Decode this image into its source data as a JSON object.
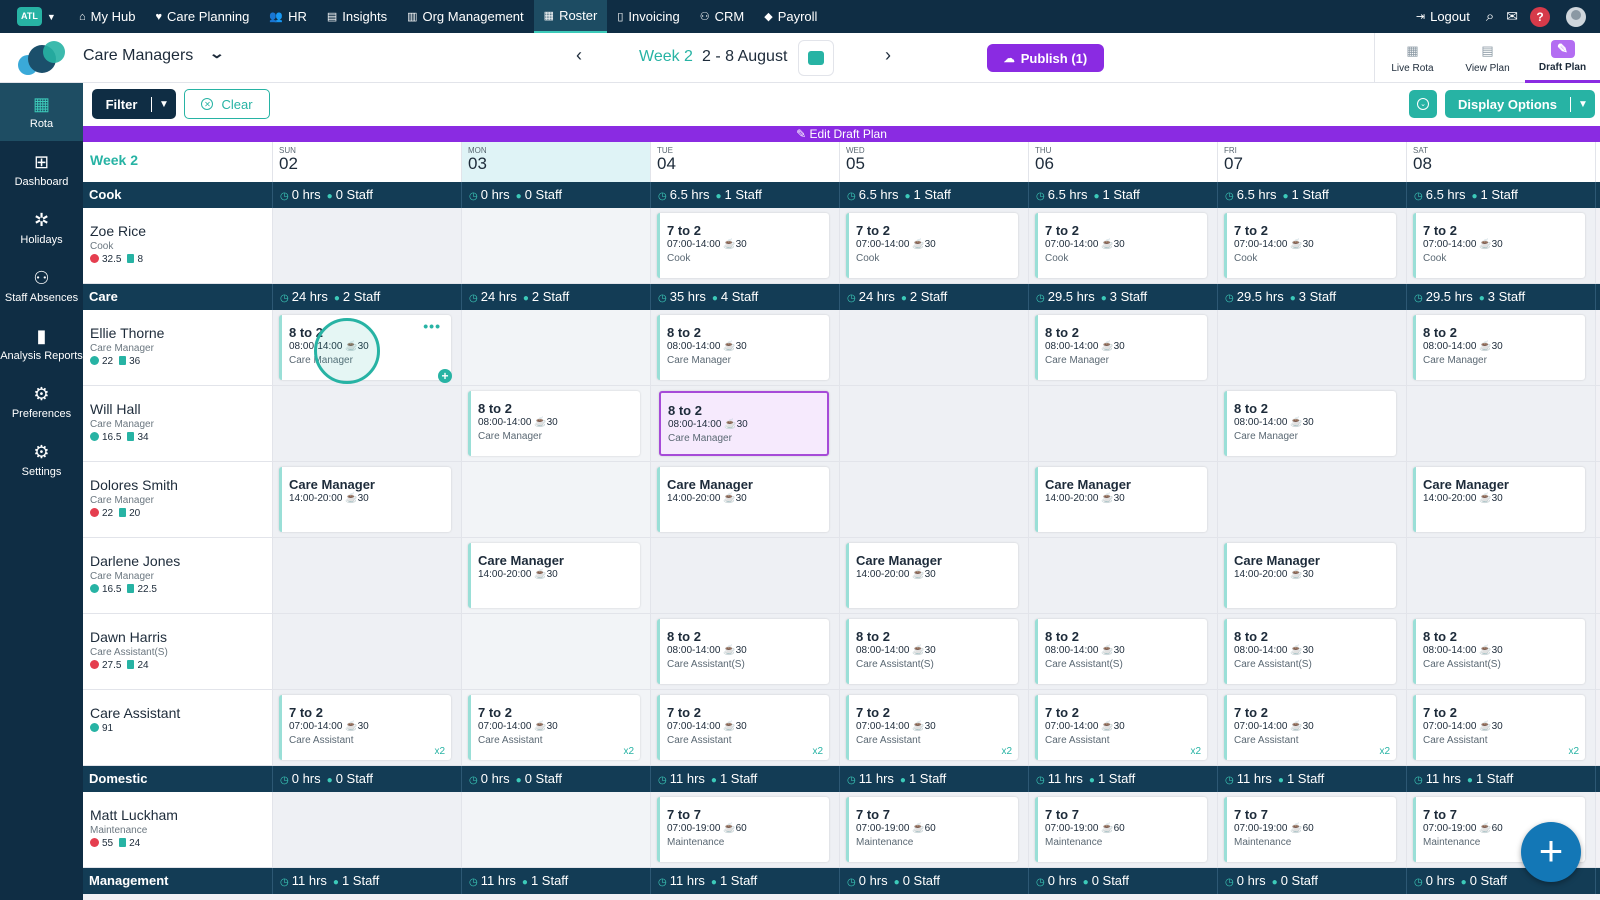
{
  "topnav": {
    "brand": "ATL",
    "items": [
      {
        "label": "My Hub",
        "icon": "home-icon",
        "glyph": "⌂"
      },
      {
        "label": "Care Planning",
        "icon": "heart-icon",
        "glyph": "♥"
      },
      {
        "label": "HR",
        "icon": "people-icon",
        "glyph": "👥"
      },
      {
        "label": "Insights",
        "icon": "chart-icon",
        "glyph": "▤"
      },
      {
        "label": "Org Management",
        "icon": "building-icon",
        "glyph": "▥"
      },
      {
        "label": "Roster",
        "icon": "calendar-icon",
        "glyph": "▦",
        "active": true
      },
      {
        "label": "Invoicing",
        "icon": "document-icon",
        "glyph": "▯"
      },
      {
        "label": "CRM",
        "icon": "contacts-icon",
        "glyph": "⚇"
      },
      {
        "label": "Payroll",
        "icon": "payroll-icon",
        "glyph": "◆"
      }
    ],
    "logout": "Logout",
    "help": "?"
  },
  "header": {
    "unit": "Care Managers",
    "week_label": "Week 2",
    "week_range": "2 - 8 August",
    "publish": "Publish (1)",
    "views": [
      {
        "label": "Live Rota",
        "icon": "live-rota-icon",
        "glyph": "▦"
      },
      {
        "label": "View Plan",
        "icon": "view-plan-icon",
        "glyph": "▤"
      },
      {
        "label": "Draft Plan",
        "icon": "draft-plan-icon",
        "glyph": "✎",
        "active": true
      }
    ]
  },
  "sidebar": {
    "items": [
      {
        "label": "Rota",
        "icon": "rota-icon",
        "glyph": "▦",
        "active": true
      },
      {
        "label": "Dashboard",
        "icon": "dashboard-icon",
        "glyph": "⊞"
      },
      {
        "label": "Holidays",
        "icon": "palm-tree-icon",
        "glyph": "✲"
      },
      {
        "label": "Staff Absences",
        "icon": "staff-absences-icon",
        "glyph": "⚇"
      },
      {
        "label": "Analysis Reports",
        "icon": "report-icon",
        "glyph": "▮"
      },
      {
        "label": "Preferences",
        "icon": "preferences-icon",
        "glyph": "⚙"
      },
      {
        "label": "Settings",
        "icon": "settings-icon",
        "glyph": "⚙"
      }
    ]
  },
  "toolbar": {
    "filter": "Filter",
    "clear": "Clear",
    "display_options": "Display Options"
  },
  "grid": {
    "draft_banner": "Edit Draft Plan",
    "week": "Week 2",
    "days": [
      {
        "name": "SUN",
        "num": "02"
      },
      {
        "name": "MON",
        "num": "03",
        "today": true
      },
      {
        "name": "TUE",
        "num": "04"
      },
      {
        "name": "WED",
        "num": "05"
      },
      {
        "name": "THU",
        "num": "06"
      },
      {
        "name": "FRI",
        "num": "07"
      },
      {
        "name": "SAT",
        "num": "08"
      }
    ],
    "rows": [
      {
        "type": "group",
        "label": "Cook",
        "summaries": [
          {
            "hrs": "0 hrs",
            "staff": "0 Staff"
          },
          {
            "hrs": "0 hrs",
            "staff": "0 Staff"
          },
          {
            "hrs": "6.5 hrs",
            "staff": "1 Staff"
          },
          {
            "hrs": "6.5 hrs",
            "staff": "1 Staff"
          },
          {
            "hrs": "6.5 hrs",
            "staff": "1 Staff"
          },
          {
            "hrs": "6.5 hrs",
            "staff": "1 Staff"
          },
          {
            "hrs": "6.5 hrs",
            "staff": "1 Staff"
          }
        ]
      },
      {
        "type": "staff",
        "name": "Zoe Rice",
        "role": "Cook",
        "stat1": "32.5",
        "stat1_color": "#e53e4f",
        "stat2": "8",
        "cells": [
          null,
          null,
          {
            "title": "7 to 2",
            "time": "07:00-14:00",
            "break": "30",
            "role": "Cook"
          },
          {
            "title": "7 to 2",
            "time": "07:00-14:00",
            "break": "30",
            "role": "Cook"
          },
          {
            "title": "7 to 2",
            "time": "07:00-14:00",
            "break": "30",
            "role": "Cook"
          },
          {
            "title": "7 to 2",
            "time": "07:00-14:00",
            "break": "30",
            "role": "Cook"
          },
          {
            "title": "7 to 2",
            "time": "07:00-14:00",
            "break": "30",
            "role": "Cook"
          }
        ]
      },
      {
        "type": "group",
        "label": "Care",
        "summaries": [
          {
            "hrs": "24 hrs",
            "staff": "2 Staff"
          },
          {
            "hrs": "24 hrs",
            "staff": "2 Staff"
          },
          {
            "hrs": "35 hrs",
            "staff": "4 Staff"
          },
          {
            "hrs": "24 hrs",
            "staff": "2 Staff"
          },
          {
            "hrs": "29.5 hrs",
            "staff": "3 Staff"
          },
          {
            "hrs": "29.5 hrs",
            "staff": "3 Staff"
          },
          {
            "hrs": "29.5 hrs",
            "staff": "3 Staff"
          }
        ]
      },
      {
        "type": "staff",
        "name": "Ellie Thorne",
        "role": "Care Manager",
        "stat1": "22",
        "stat1_color": "#27b3a4",
        "stat2": "36",
        "cells": [
          {
            "title": "8 to 2",
            "time": "08:00-14:00",
            "break": "30",
            "role": "Care Manager",
            "menu": "•••",
            "plus": "+",
            "cursor": true
          },
          null,
          {
            "title": "8 to 2",
            "time": "08:00-14:00",
            "break": "30",
            "role": "Care Manager"
          },
          null,
          {
            "title": "8 to 2",
            "time": "08:00-14:00",
            "break": "30",
            "role": "Care Manager"
          },
          null,
          {
            "title": "8 to 2",
            "time": "08:00-14:00",
            "break": "30",
            "role": "Care Manager"
          }
        ]
      },
      {
        "type": "staff",
        "name": "Will Hall",
        "role": "Care Manager",
        "stat1": "16.5",
        "stat1_color": "#27b3a4",
        "stat2": "34",
        "cells": [
          null,
          {
            "title": "8 to 2",
            "time": "08:00-14:00",
            "break": "30",
            "role": "Care Manager"
          },
          {
            "title": "8 to 2",
            "time": "08:00-14:00",
            "break": "30",
            "role": "Care Manager",
            "selected": true
          },
          null,
          null,
          {
            "title": "8 to 2",
            "time": "08:00-14:00",
            "break": "30",
            "role": "Care Manager"
          },
          null
        ]
      },
      {
        "type": "staff",
        "name": "Dolores Smith",
        "role": "Care Manager",
        "stat1": "22",
        "stat1_color": "#e53e4f",
        "stat2": "20",
        "cells": [
          {
            "title": "Care Manager",
            "time": "14:00-20:00",
            "break": "30"
          },
          null,
          {
            "title": "Care Manager",
            "time": "14:00-20:00",
            "break": "30"
          },
          null,
          {
            "title": "Care Manager",
            "time": "14:00-20:00",
            "break": "30"
          },
          null,
          {
            "title": "Care Manager",
            "time": "14:00-20:00",
            "break": "30"
          }
        ]
      },
      {
        "type": "staff",
        "name": "Darlene Jones",
        "role": "Care Manager",
        "stat1": "16.5",
        "stat1_color": "#27b3a4",
        "stat2": "22.5",
        "cells": [
          null,
          {
            "title": "Care Manager",
            "time": "14:00-20:00",
            "break": "30"
          },
          null,
          {
            "title": "Care Manager",
            "time": "14:00-20:00",
            "break": "30"
          },
          null,
          {
            "title": "Care Manager",
            "time": "14:00-20:00",
            "break": "30"
          },
          null
        ]
      },
      {
        "type": "staff",
        "name": "Dawn Harris",
        "role": "Care Assistant(S)",
        "stat1": "27.5",
        "stat1_color": "#e53e4f",
        "stat2": "24",
        "cells": [
          null,
          null,
          {
            "title": "8 to 2",
            "time": "08:00-14:00",
            "break": "30",
            "role": "Care Assistant(S)"
          },
          {
            "title": "8 to 2",
            "time": "08:00-14:00",
            "break": "30",
            "role": "Care Assistant(S)"
          },
          {
            "title": "8 to 2",
            "time": "08:00-14:00",
            "break": "30",
            "role": "Care Assistant(S)"
          },
          {
            "title": "8 to 2",
            "time": "08:00-14:00",
            "break": "30",
            "role": "Care Assistant(S)"
          },
          {
            "title": "8 to 2",
            "time": "08:00-14:00",
            "break": "30",
            "role": "Care Assistant(S)"
          }
        ]
      },
      {
        "type": "staff",
        "name": "Care Assistant",
        "role": "",
        "stat1": "91",
        "stat1_color": "#27b3a4",
        "stat2": "",
        "cells": [
          {
            "title": "7 to 2",
            "time": "07:00-14:00",
            "break": "30",
            "role": "Care Assistant",
            "mult": "x2"
          },
          {
            "title": "7 to 2",
            "time": "07:00-14:00",
            "break": "30",
            "role": "Care Assistant",
            "mult": "x2"
          },
          {
            "title": "7 to 2",
            "time": "07:00-14:00",
            "break": "30",
            "role": "Care Assistant",
            "mult": "x2"
          },
          {
            "title": "7 to 2",
            "time": "07:00-14:00",
            "break": "30",
            "role": "Care Assistant",
            "mult": "x2"
          },
          {
            "title": "7 to 2",
            "time": "07:00-14:00",
            "break": "30",
            "role": "Care Assistant",
            "mult": "x2"
          },
          {
            "title": "7 to 2",
            "time": "07:00-14:00",
            "break": "30",
            "role": "Care Assistant",
            "mult": "x2"
          },
          {
            "title": "7 to 2",
            "time": "07:00-14:00",
            "break": "30",
            "role": "Care Assistant",
            "mult": "x2"
          }
        ]
      },
      {
        "type": "group",
        "label": "Domestic",
        "summaries": [
          {
            "hrs": "0 hrs",
            "staff": "0 Staff"
          },
          {
            "hrs": "0 hrs",
            "staff": "0 Staff"
          },
          {
            "hrs": "11 hrs",
            "staff": "1 Staff"
          },
          {
            "hrs": "11 hrs",
            "staff": "1 Staff"
          },
          {
            "hrs": "11 hrs",
            "staff": "1 Staff"
          },
          {
            "hrs": "11 hrs",
            "staff": "1 Staff"
          },
          {
            "hrs": "11 hrs",
            "staff": "1 Staff"
          }
        ]
      },
      {
        "type": "staff",
        "name": "Matt Luckham",
        "role": "Maintenance",
        "stat1": "55",
        "stat1_color": "#e53e4f",
        "stat2": "24",
        "cells": [
          null,
          null,
          {
            "title": "7 to 7",
            "time": "07:00-19:00",
            "break": "60",
            "role": "Maintenance"
          },
          {
            "title": "7 to 7",
            "time": "07:00-19:00",
            "break": "60",
            "role": "Maintenance"
          },
          {
            "title": "7 to 7",
            "time": "07:00-19:00",
            "break": "60",
            "role": "Maintenance"
          },
          {
            "title": "7 to 7",
            "time": "07:00-19:00",
            "break": "60",
            "role": "Maintenance"
          },
          {
            "title": "7 to 7",
            "time": "07:00-19:00",
            "break": "60",
            "role": "Maintenance"
          }
        ]
      },
      {
        "type": "group",
        "label": "Management",
        "summaries": [
          {
            "hrs": "11 hrs",
            "staff": "1 Staff"
          },
          {
            "hrs": "11 hrs",
            "staff": "1 Staff"
          },
          {
            "hrs": "11 hrs",
            "staff": "1 Staff"
          },
          {
            "hrs": "0 hrs",
            "staff": "0 Staff"
          },
          {
            "hrs": "0 hrs",
            "staff": "0 Staff"
          },
          {
            "hrs": "0 hrs",
            "staff": "0 Staff"
          },
          {
            "hrs": "0 hrs",
            "staff": "0 Staff"
          }
        ]
      }
    ]
  },
  "fab": "+",
  "colors": {
    "teal": "#27b3a4",
    "navy": "#0f2d44",
    "purple": "#8a2be2",
    "red": "#e53e4f"
  }
}
